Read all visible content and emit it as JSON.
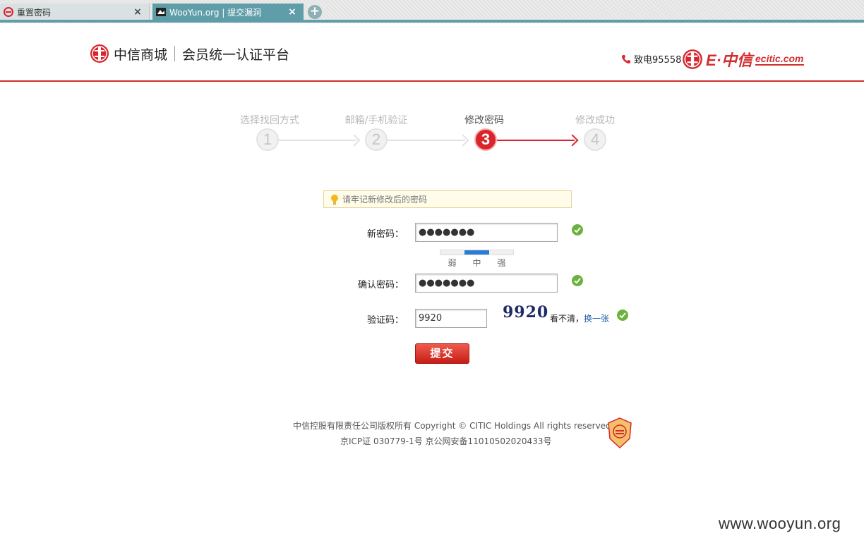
{
  "browser": {
    "tabs": [
      {
        "label": "重置密码",
        "active": false
      },
      {
        "label": "WooYun.org | 提交漏洞",
        "active": true
      }
    ],
    "close_glyph": "×",
    "new_tab_glyph": "+"
  },
  "header": {
    "brand_name": "中信商城",
    "platform_name": "会员统一认证平台",
    "hotline": "致电95558",
    "right_brand_cn": "E·中信",
    "right_brand_domain": "ecitic.com"
  },
  "steps": [
    {
      "number": "1",
      "label": "选择找回方式",
      "active": false
    },
    {
      "number": "2",
      "label": "邮箱/手机验证",
      "active": false
    },
    {
      "number": "3",
      "label": "修改密码",
      "active": true
    },
    {
      "number": "4",
      "label": "修改成功",
      "active": false
    }
  ],
  "tip": {
    "text": "请牢记新修改后的密码"
  },
  "form": {
    "new_password_label": "新密码：",
    "new_password_value": "●●●●●●●",
    "confirm_password_label": "确认密码：",
    "confirm_password_value": "●●●●●●●",
    "strength": {
      "levels": [
        "弱",
        "中",
        "强"
      ],
      "current": "中"
    },
    "captcha_label": "验证码：",
    "captcha_value": "9920",
    "captcha_image_text": "9920",
    "captcha_hint": "看不清，",
    "captcha_refresh": "换一张",
    "submit_label": "提交"
  },
  "footer": {
    "copyright": "中信控股有限责任公司版权所有  Copyright © CITIC Holdings All rights reserved",
    "icp": "京ICP证  030779-1号  京公网安备11010502020433号"
  },
  "watermark": "www.wooyun.org",
  "colors": {
    "brand_red": "#d9252b",
    "tab_teal": "#5f9ea8",
    "success_green": "#6cb33e",
    "link_blue": "#1a5aa8"
  }
}
